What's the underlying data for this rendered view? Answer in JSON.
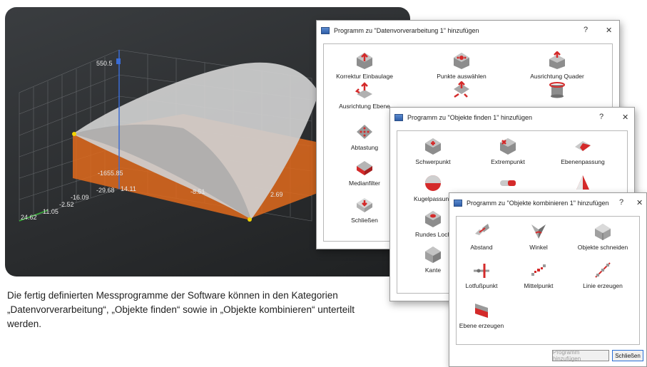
{
  "viewer": {
    "z_max_label": "550.5",
    "labels": [
      "-1655.85",
      "-29.68",
      "14.11",
      "-8.51",
      "-16.09",
      "-2.52",
      "2.69",
      "11.05",
      "24.62"
    ]
  },
  "caption": {
    "text": "Die fertig definierten Messprogramme der Software können in den Kategorien „Datenvorverarbeitung“, „Objekte finden“ sowie in „Objekte kombinieren“ unterteilt werden."
  },
  "dialog1": {
    "title": "Programm zu \"Datenvorverarbeitung 1\" hinzufügen",
    "help": "?",
    "close": "✕",
    "items": [
      "Korrektur Einbaulage",
      "Punkte auswählen",
      "Ausrichtung Quader",
      "Ausrichtung Ebene",
      "",
      "",
      "Abtastung",
      "Medianfilter",
      "Schließen"
    ]
  },
  "dialog2": {
    "title": "Programm zu \"Objekte finden 1\" hinzufügen",
    "help": "?",
    "close": "✕",
    "items": [
      "Schwerpunkt",
      "Extrempunkt",
      "Ebenenpassung",
      "Kugelpassung",
      "Rundes Loch",
      "Kante"
    ]
  },
  "dialog3": {
    "title": "Programm zu \"Objekte kombinieren 1\" hinzufügen",
    "help": "?",
    "close": "✕",
    "items": [
      "Abstand",
      "Winkel",
      "Objekte schneiden",
      "Lotfußpunkt",
      "Mittelpunkt",
      "Linie erzeugen",
      "Ebene erzeugen"
    ],
    "add_button": "Programm hinzufügen",
    "close_button": "Schließen"
  },
  "colors": {
    "accent": "#d42a2a",
    "surface_orange": "#e06a1c",
    "surface_gray": "#c9c9c9"
  }
}
